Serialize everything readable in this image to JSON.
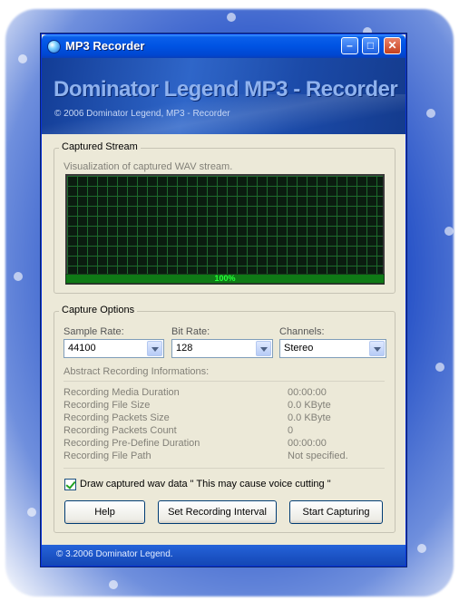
{
  "window": {
    "title": "MP3 Recorder",
    "controls": {
      "minimize": "–",
      "maximize": "□",
      "close": "✕"
    }
  },
  "banner": {
    "title": "Dominator Legend MP3 - Recorder",
    "subtitle": "© 2006 Dominator Legend, MP3 - Recorder"
  },
  "captured_stream": {
    "legend": "Captured Stream",
    "description": "Visualization of captured WAV stream.",
    "level_text": "100%",
    "level_fraction": 1.0
  },
  "capture_options": {
    "legend": "Capture Options",
    "sample_rate": {
      "label": "Sample Rate:",
      "value": "44100"
    },
    "bit_rate": {
      "label": "Bit Rate:",
      "value": "128"
    },
    "channels": {
      "label": "Channels:",
      "value": "Stereo"
    },
    "info_heading": "Abstract Recording Informations:",
    "info": [
      {
        "label": "Recording Media Duration",
        "value": "00:00:00"
      },
      {
        "label": "Recording File Size",
        "value": "0.0 KByte"
      },
      {
        "label": "Recording Packets Size",
        "value": "0.0 KByte"
      },
      {
        "label": "Recording Packets Count",
        "value": "0"
      },
      {
        "label": "Recording Pre-Define Duration",
        "value": "00:00:00"
      },
      {
        "label": "Recording File Path",
        "value": "Not specified."
      }
    ],
    "draw_checkbox": {
      "label": "Draw captured wav data \" This may cause voice cutting \"",
      "checked": true
    }
  },
  "buttons": {
    "help": "Help",
    "set_interval": "Set Recording Interval",
    "start": "Start Capturing"
  },
  "status": {
    "text": "© 3.2006 Dominator Legend."
  },
  "colors": {
    "titlebar": "#0053e3",
    "scope_grid": "#1d6b2c",
    "level_fill": "#0f7a16",
    "level_text": "#26ff3a"
  }
}
